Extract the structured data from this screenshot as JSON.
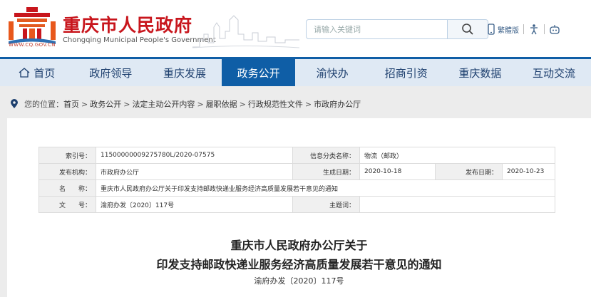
{
  "header": {
    "url": "WWW.CQ.GOV.CN",
    "title_cn": "重庆市人民政府",
    "title_en": "Chongqing Municipal People's Government",
    "search_placeholder": "请输入关键词",
    "tools": {
      "mobile_label": "繁體版"
    },
    "colors": {
      "brand_red": "#c8161d",
      "nav_blue": "#0f5ea6"
    }
  },
  "nav": {
    "items": [
      {
        "label": "首页"
      },
      {
        "label": "政府领导"
      },
      {
        "label": "重庆发展"
      },
      {
        "label": "政务公开"
      },
      {
        "label": "渝快办"
      },
      {
        "label": "招商引资"
      },
      {
        "label": "重庆数据"
      },
      {
        "label": "互动交流"
      }
    ],
    "active_index": 3
  },
  "breadcrumb": {
    "prefix": "您的位置：",
    "items": [
      "首页",
      "政务公开",
      "法定主动公开内容",
      "履职依据",
      "行政规范性文件",
      "市政府办公厅"
    ]
  },
  "info": {
    "index_label": "索引号：",
    "index_value": "11500000009275780L/2020-07575",
    "category_label": "信息分类名称：",
    "category_value": "物流（邮政）",
    "org_label": "发布机构：",
    "org_value": "市政府办公厅",
    "created_label": "生成日期：",
    "created_value": "2020-10-18",
    "published_label": "发布日期：",
    "published_value": "2020-10-23",
    "name_label": "名　　称：",
    "name_value": "重庆市人民政府办公厅关于印发支持邮政快递业服务经济高质量发展若干意见的通知",
    "docno_label": "文　　号：",
    "docno_value": "渝府办发〔2020〕117号",
    "subject_label": "主题词：",
    "subject_value": ""
  },
  "document": {
    "title_line1": "重庆市人民政府办公厅关于",
    "title_line2": "印发支持邮政快递业服务经济高质量发展若干意见的通知",
    "doc_no": "渝府办发〔2020〕117号"
  }
}
